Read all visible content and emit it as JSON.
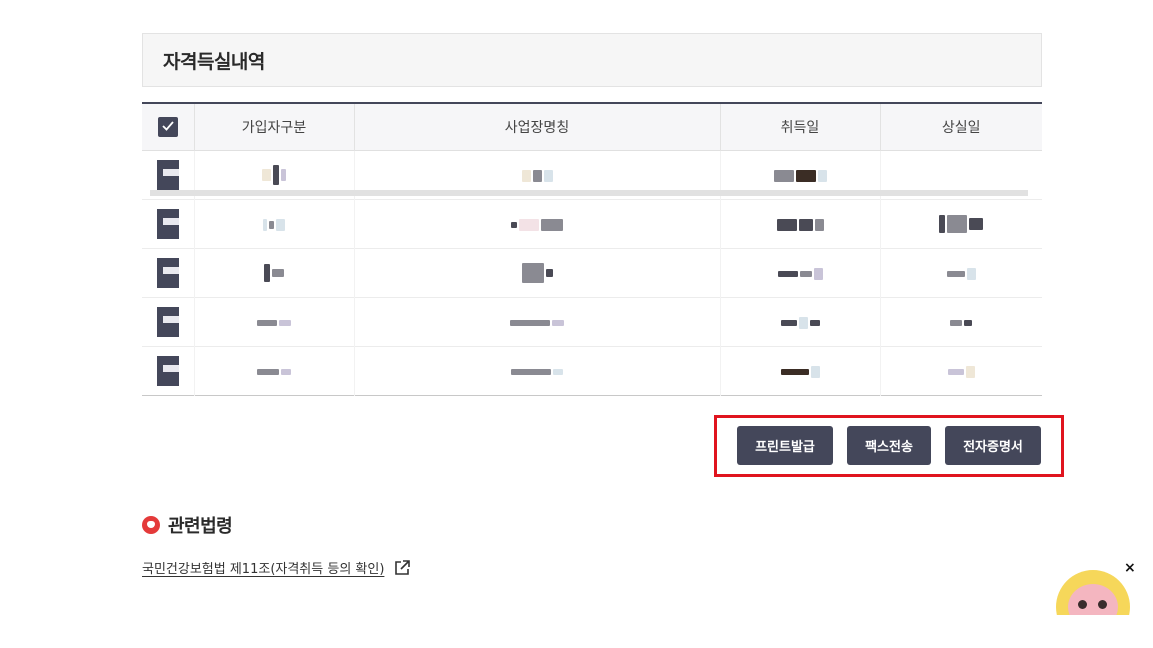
{
  "section": {
    "title": "자격득실내역"
  },
  "table": {
    "headers": {
      "type": "가입자구분",
      "workplace": "사업장명칭",
      "acquired": "취득일",
      "lost": "상실일"
    },
    "check_icon": "check-icon"
  },
  "buttons": {
    "print": "프린트발급",
    "fax": "팩스전송",
    "cert": "전자증명서"
  },
  "law": {
    "title": "관련법령",
    "link": "국민건강보험법 제11조(자격취득 등의 확인)",
    "link_icon": "external-link-icon"
  },
  "widget": {
    "close": "×"
  },
  "colors": {
    "dark_button": "#44475a",
    "highlight_border": "#e0141e",
    "law_icon": "#e43a3a"
  }
}
